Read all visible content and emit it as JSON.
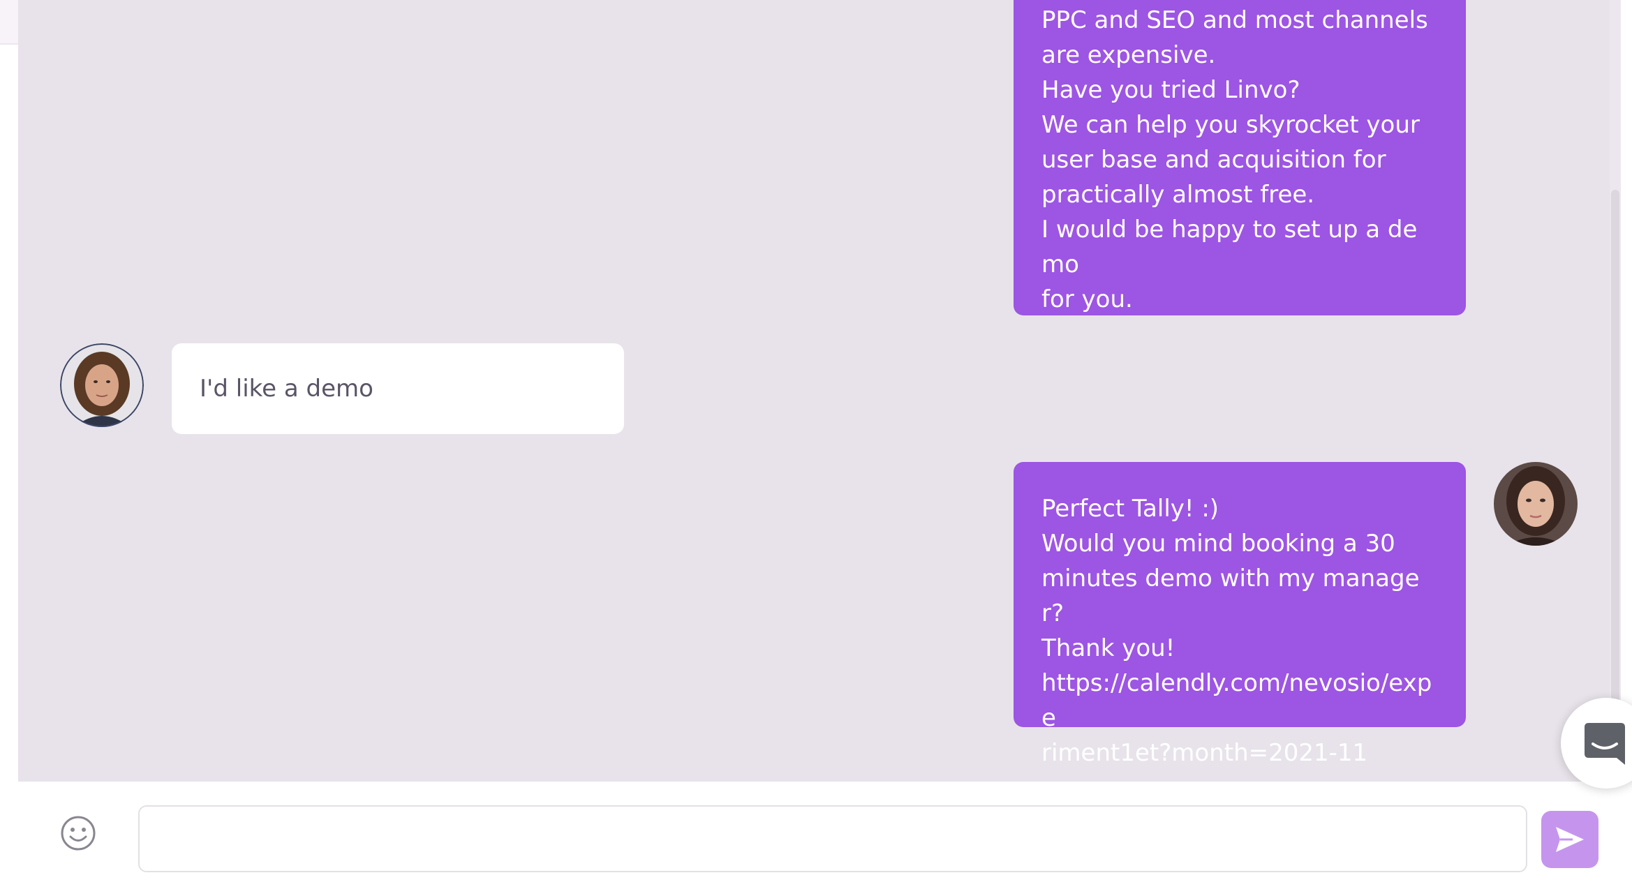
{
  "messages": [
    {
      "sender": "agent",
      "text": "PPC and SEO and most channels\nare expensive.\nHave you tried Linvo?\nWe can help you skyrocket your\nuser base and acquisition for\npractically almost free.\nI would be happy to set up a demo\nfor you."
    },
    {
      "sender": "user",
      "text": "I'd like a demo"
    },
    {
      "sender": "agent",
      "text": "Perfect Tally! :)\nWould you mind booking a 30\nminutes demo with my manager?\nThank you!\nhttps://calendly.com/nevosio/expe\nriment1et?month=2021-11"
    }
  ],
  "composer": {
    "value": "",
    "placeholder": ""
  },
  "icons": {
    "emoji": "smiley-face-icon",
    "send": "paper-plane-icon",
    "launcher": "chat-bubble-icon"
  },
  "colors": {
    "agent_bubble": "#9d55e3",
    "user_bubble": "#ffffff",
    "chat_background": "#e8e3ea",
    "send_button": "#c595ee"
  }
}
